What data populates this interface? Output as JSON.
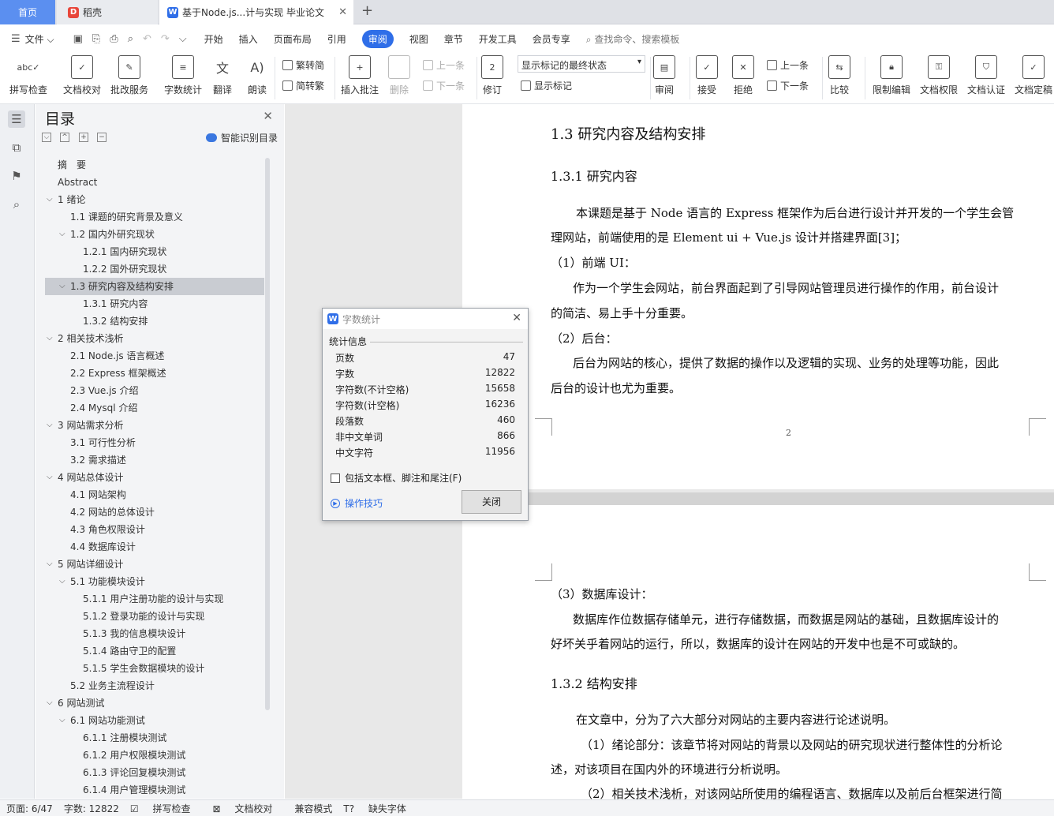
{
  "tabs": {
    "home": "首页",
    "daoke": "稻壳",
    "doc": "基于Node.js...计与实现 毕业论文"
  },
  "menu": {
    "file": "文件",
    "items": [
      "开始",
      "插入",
      "页面布局",
      "引用",
      "审阅",
      "视图",
      "章节",
      "开发工具",
      "会员专享"
    ],
    "search": "查找命令、搜索模板"
  },
  "ribbon": {
    "spell": "拼写检查",
    "proof": "文档校对",
    "correct": "批改服务",
    "wordcount": "字数统计",
    "translate": "翻译",
    "read": "朗读",
    "trad": "繁转简",
    "simp": "简转繁",
    "insert_comment": "插入批注",
    "delete": "删除",
    "prev": "上一条",
    "next": "下一条",
    "revise": "修订",
    "show_state": "显示标记的最终状态",
    "show_marks": "显示标记",
    "review": "审阅",
    "accept": "接受",
    "reject": "拒绝",
    "prev2": "上一条",
    "next2": "下一条",
    "compare": "比较",
    "restrict": "限制编辑",
    "rights": "文档权限",
    "cert": "文档认证",
    "finalize": "文档定稿"
  },
  "toc": {
    "title": "目录",
    "smart": "智能识别目录",
    "items": [
      {
        "text": "摘　要",
        "level": 0,
        "arrow": ""
      },
      {
        "text": "Abstract",
        "level": 0,
        "arrow": ""
      },
      {
        "text": "1 绪论",
        "level": 0,
        "arrow": "v"
      },
      {
        "text": "1.1  课题的研究背景及意义",
        "level": 1,
        "arrow": ""
      },
      {
        "text": "1.2  国内外研究现状",
        "level": 1,
        "arrow": "v"
      },
      {
        "text": "1.2.1 国内研究现状",
        "level": 2,
        "arrow": ""
      },
      {
        "text": "1.2.2 国外研究现状",
        "level": 2,
        "arrow": ""
      },
      {
        "text": "1.3  研究内容及结构安排",
        "level": 1,
        "arrow": "v",
        "selected": true
      },
      {
        "text": "1.3.1  研究内容",
        "level": 2,
        "arrow": ""
      },
      {
        "text": "1.3.2  结构安排",
        "level": 2,
        "arrow": ""
      },
      {
        "text": "2 相关技术浅析",
        "level": 0,
        "arrow": "v"
      },
      {
        "text": "2.1 Node.js 语言概述",
        "level": 1,
        "arrow": ""
      },
      {
        "text": "2.2 Express 框架概述",
        "level": 1,
        "arrow": ""
      },
      {
        "text": "2.3 Vue.js 介绍",
        "level": 1,
        "arrow": ""
      },
      {
        "text": "2.4 Mysql 介绍",
        "level": 1,
        "arrow": ""
      },
      {
        "text": "3 网站需求分析",
        "level": 0,
        "arrow": "v"
      },
      {
        "text": "3.1 可行性分析",
        "level": 1,
        "arrow": ""
      },
      {
        "text": "3.2 需求描述",
        "level": 1,
        "arrow": ""
      },
      {
        "text": "4 网站总体设计",
        "level": 0,
        "arrow": "v"
      },
      {
        "text": "4.1  网站架构",
        "level": 1,
        "arrow": ""
      },
      {
        "text": "4.2  网站的总体设计",
        "level": 1,
        "arrow": ""
      },
      {
        "text": "4.3  角色权限设计",
        "level": 1,
        "arrow": ""
      },
      {
        "text": "4.4  数据库设计",
        "level": 1,
        "arrow": ""
      },
      {
        "text": "5 网站详细设计",
        "level": 0,
        "arrow": "v"
      },
      {
        "text": "5.1  功能模块设计",
        "level": 1,
        "arrow": "v"
      },
      {
        "text": "5.1.1  用户注册功能的设计与实现",
        "level": 2,
        "arrow": ""
      },
      {
        "text": "5.1.2  登录功能的设计与实现",
        "level": 2,
        "arrow": ""
      },
      {
        "text": "5.1.3  我的信息模块设计",
        "level": 2,
        "arrow": ""
      },
      {
        "text": "5.1.4  路由守卫的配置",
        "level": 2,
        "arrow": ""
      },
      {
        "text": "5.1.5  学生会数据模块的设计",
        "level": 2,
        "arrow": ""
      },
      {
        "text": "5.2 业务主流程设计",
        "level": 1,
        "arrow": ""
      },
      {
        "text": "6 网站测试",
        "level": 0,
        "arrow": "v"
      },
      {
        "text": "6.1  网站功能测试",
        "level": 1,
        "arrow": "v"
      },
      {
        "text": "6.1.1  注册模块测试",
        "level": 2,
        "arrow": ""
      },
      {
        "text": "6.1.2  用户权限模块测试",
        "level": 2,
        "arrow": ""
      },
      {
        "text": "6.1.3  评论回复模块测试",
        "level": 2,
        "arrow": ""
      },
      {
        "text": "6.1.4  用户管理模块测试",
        "level": 2,
        "arrow": ""
      }
    ]
  },
  "doc": {
    "h_13": "1.3  研究内容及结构安排",
    "h_131": "1.3.1  研究内容",
    "p1a": "本课题是基于 Node 语言的 Express 框架作为后台进行设计并开发的一个学生会管",
    "p1b": "理网站，前端使用的是  Element ui + Vue.js  设计并搭建界面[3]；",
    "l1": "（1）前端 UI：",
    "p2a": "作为一个学生会网站，前台界面起到了引导网站管理员进行操作的作用，前台设计",
    "p2b": "的简洁、易上手十分重要。",
    "l2": "（2）后台：",
    "p3a": "后台为网站的核心，提供了数据的操作以及逻辑的实现、业务的处理等功能，因此",
    "p3b": "后台的设计也尤为重要。",
    "pagenum": "2",
    "l3": "（3）数据库设计：",
    "p4a": "数据库作位数据存储单元，进行存储数据，而数据是网站的基础，且数据库设计的",
    "p4b": "好坏关乎着网站的运行，所以，数据库的设计在网站的开发中也是不可或缺的。",
    "h_132": "1.3.2  结构安排",
    "p5": "在文章中，分为了六大部分对网站的主要内容进行论述说明。",
    "p6a": "（1）绪论部分：该章节将对网站的背景以及网站的研究现状进行整体性的分析论",
    "p6b": "述，对该项目在国内外的环境进行分析说明。",
    "p7": "（2）相关技术浅析，对该网站所使用的编程语言、数据库以及前后台框架进行简"
  },
  "dialog": {
    "title": "字数统计",
    "group": "统计信息",
    "rows": [
      {
        "label": "页数",
        "value": "47"
      },
      {
        "label": "字数",
        "value": "12822"
      },
      {
        "label": "字符数(不计空格)",
        "value": "15658"
      },
      {
        "label": "字符数(计空格)",
        "value": "16236"
      },
      {
        "label": "段落数",
        "value": "460"
      },
      {
        "label": "非中文单词",
        "value": "866"
      },
      {
        "label": "中文字符",
        "value": "11956"
      }
    ],
    "checkbox": "包括文本框、脚注和尾注(F)",
    "tips": "操作技巧",
    "close": "关闭"
  },
  "status": {
    "page": "页面: 6/47",
    "words": "字数: 12822",
    "spell": "拼写检查",
    "proof": "文档校对",
    "compat": "兼容模式",
    "font": "缺失字体"
  }
}
